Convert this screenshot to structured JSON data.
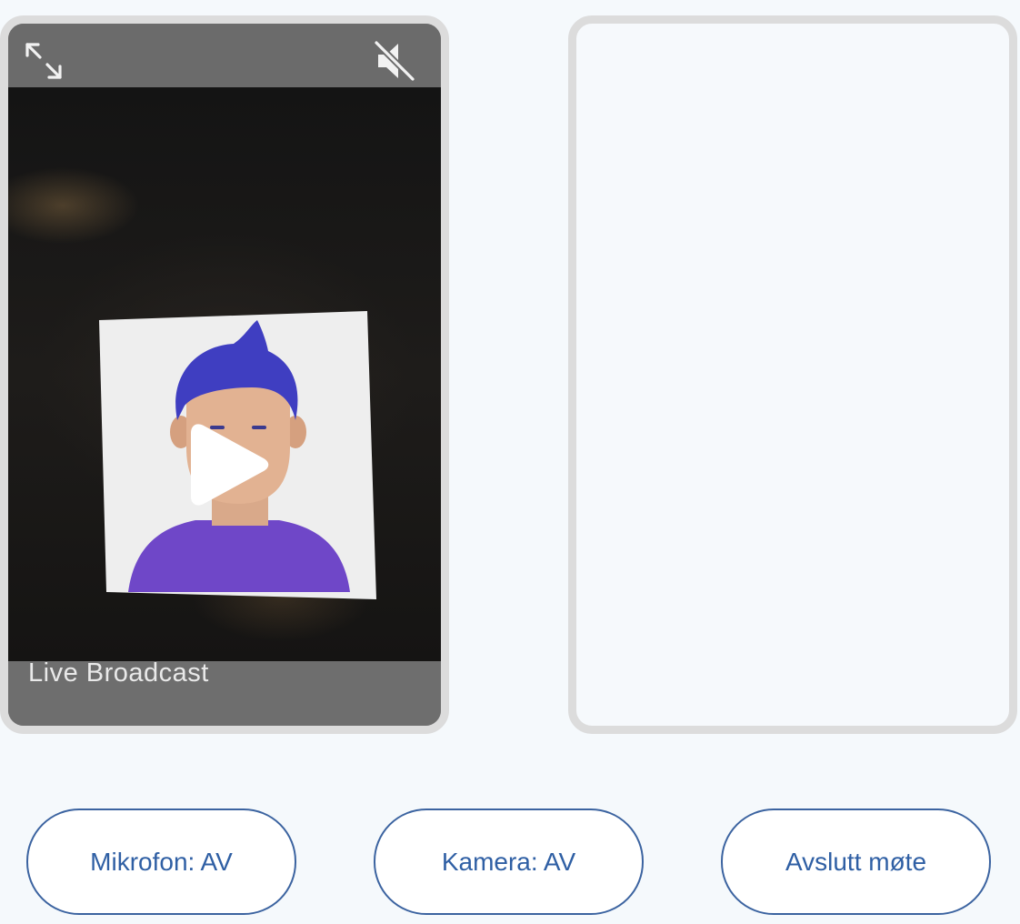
{
  "video": {
    "caption": "Live Broadcast"
  },
  "icons": {
    "expand": "expand-icon",
    "mute": "speaker-muted-icon",
    "play": "play-icon"
  },
  "controls": {
    "microphone_label": "Mikrofon: AV",
    "camera_label": "Kamera: AV",
    "end_label": "Avslutt møte"
  },
  "colors": {
    "accent": "#2f5fa4",
    "tile_border": "#dcdcdc",
    "background": "#f5f9fc"
  }
}
